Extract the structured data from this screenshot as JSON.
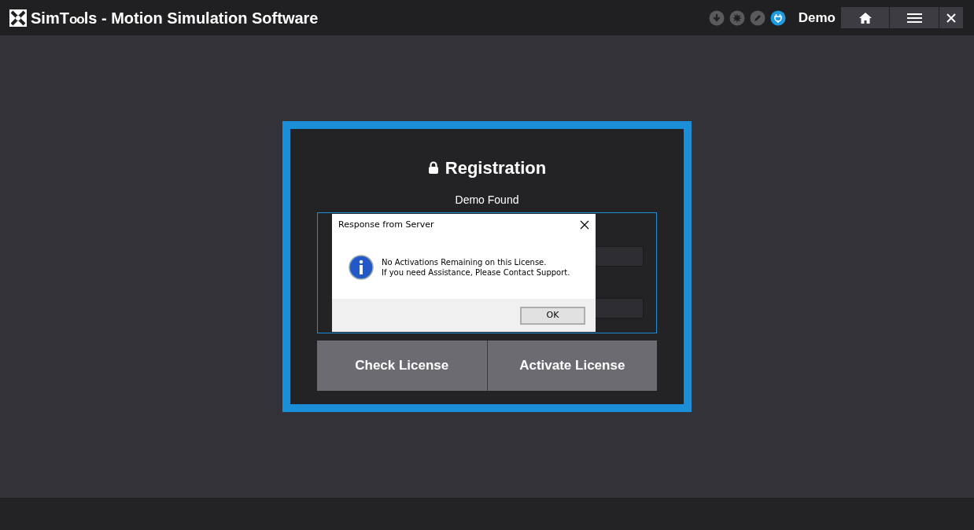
{
  "window": {
    "title_prefix": "SimT",
    "title_gears": "oo",
    "title_suffix": "ls - Motion Simulation Software",
    "user": "Demo"
  },
  "status_icons": [
    {
      "kind": "download",
      "on": false
    },
    {
      "kind": "burst",
      "on": false
    },
    {
      "kind": "pencil",
      "on": false
    },
    {
      "kind": "plug",
      "on": true
    }
  ],
  "registration": {
    "title": "Registration",
    "status": "Demo Found",
    "buttons": [
      "Check License",
      "Activate License"
    ]
  },
  "dialog": {
    "title": "Response from Server",
    "message_lines": [
      "No Activations Remaining on this License.",
      "If you need Assistance, Please Contact Support."
    ],
    "button": "OK"
  }
}
